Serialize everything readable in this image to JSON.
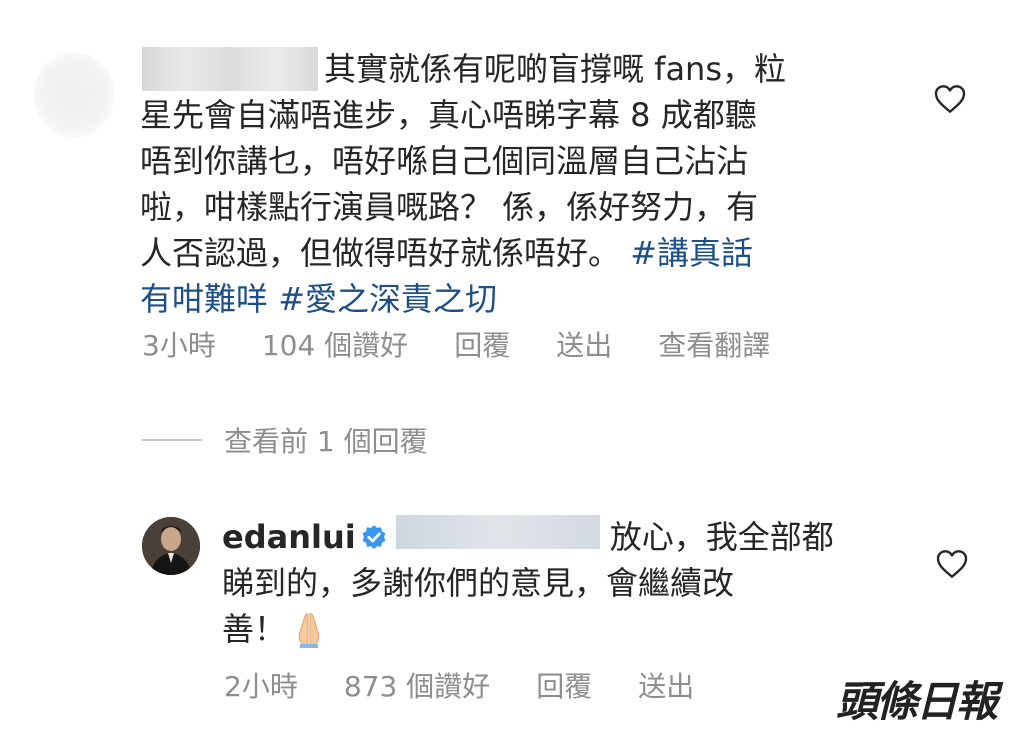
{
  "comment": {
    "text_lines": [
      "其實就係有呢啲盲撐嘅 fans，粒",
      "星先會自滿唔進步，真心唔睇字幕 8 成都聽",
      "唔到你講乜，唔好喺自己個同溫層自己沾沾",
      "啦，咁樣點行演員嘅路？ 係，係好努力，有",
      "人否認過，但做得唔好就係唔好。"
    ],
    "hashtag_1": "#講真話",
    "hashtag_1b": "有咁難咩",
    "hashtag_2": "#愛之深責之切",
    "time": "3小時",
    "likes": "104 個讚好",
    "reply": "回覆",
    "send": "送出",
    "translate": "查看翻譯"
  },
  "view_replies": "查看前 1 個回覆",
  "reply": {
    "username": "edanlui",
    "line1": "放心，我全部都",
    "line2": "睇到的，多謝你們的意見，會繼續改",
    "line3": "善！",
    "time": "2小時",
    "likes": "873 個讚好",
    "reply": "回覆",
    "send": "送出"
  },
  "watermark": "頭條日報",
  "icons": {
    "like": "heart-outline-icon",
    "verified": "verified-badge-icon",
    "emoji": "folded-hands-emoji"
  },
  "colors": {
    "hashtag": "#1e4f86",
    "meta": "#8e8e8e",
    "verified": "#3897f0"
  }
}
